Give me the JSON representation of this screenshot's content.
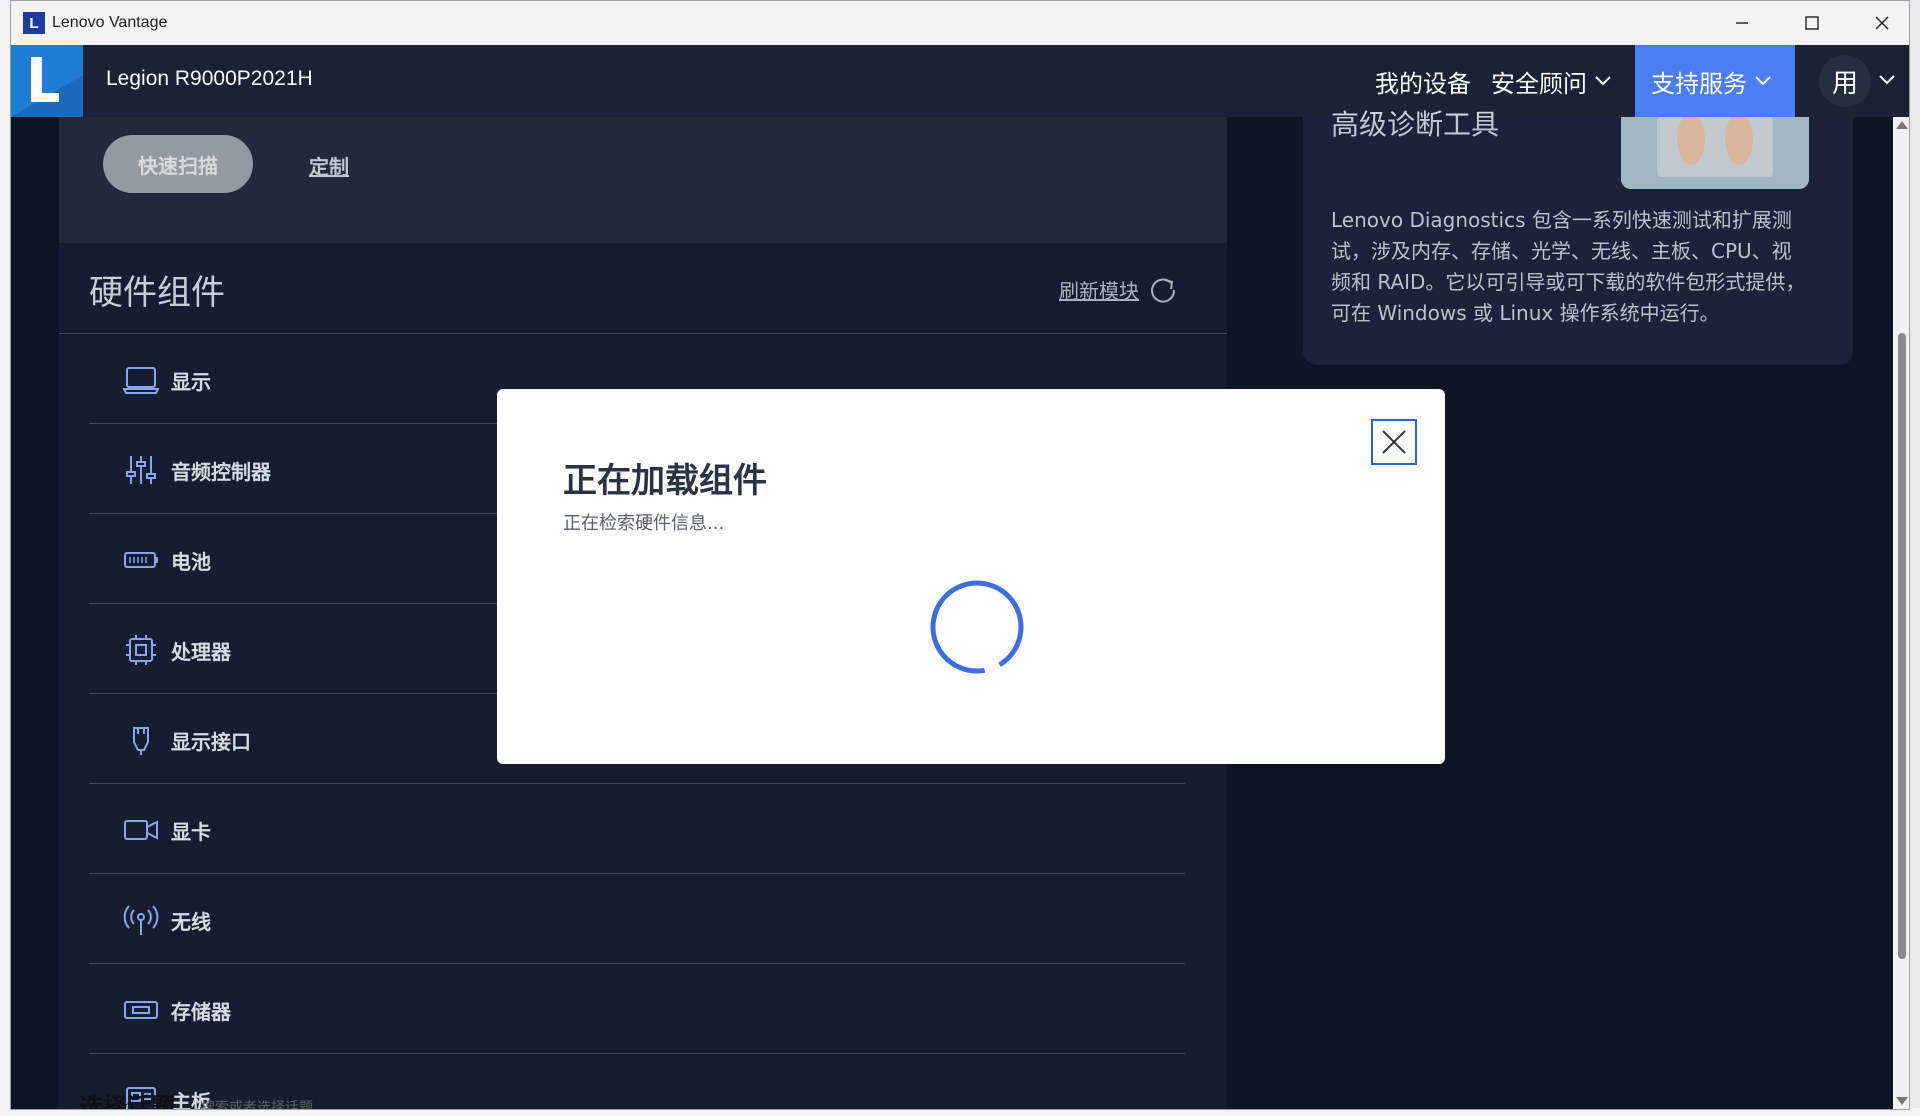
{
  "window": {
    "title": "Lenovo Vantage",
    "logo_letter": "L"
  },
  "header": {
    "device_name": "Legion R9000P2021H",
    "nav": [
      {
        "label": "我的设备"
      },
      {
        "label": "安全顾问"
      },
      {
        "label": "支持服务"
      }
    ],
    "user_initial": "用"
  },
  "scan": {
    "quick_scan_label": "快速扫描",
    "custom_label": "定制"
  },
  "hardware": {
    "title": "硬件组件",
    "refresh_label": "刷新模块",
    "items": [
      {
        "label": "显示",
        "icon": "laptop-icon"
      },
      {
        "label": "音频控制器",
        "icon": "sliders-icon"
      },
      {
        "label": "电池",
        "icon": "battery-icon"
      },
      {
        "label": "处理器",
        "icon": "cpu-icon"
      },
      {
        "label": "显示接口",
        "icon": "connector-icon"
      },
      {
        "label": "显卡",
        "icon": "video-icon"
      },
      {
        "label": "无线",
        "icon": "wireless-icon"
      },
      {
        "label": "存储器",
        "icon": "storage-icon"
      },
      {
        "label": "主板",
        "icon": "motherboard-icon"
      }
    ]
  },
  "diagnostics_card": {
    "heading": "高级诊断工具",
    "description": "Lenovo Diagnostics 包含一系列快速测试和扩展测试，涉及内存、存储、光学、无线、主板、CPU、视频和 RAID。它以可引导或可下载的软件包形式提供，可在 Windows 或 Linux 操作系统中运行。"
  },
  "dialog": {
    "title": "正在加载组件",
    "subtitle": "正在检索硬件信息..."
  },
  "bottom_partial": {
    "text": "选择话题",
    "sub": "搜索或者选择话题"
  },
  "colors": {
    "accent": "#4a7ef2",
    "header_bg": "#1b2136",
    "panel_bg": "#181f35",
    "spinner": "#3b6fe0"
  }
}
